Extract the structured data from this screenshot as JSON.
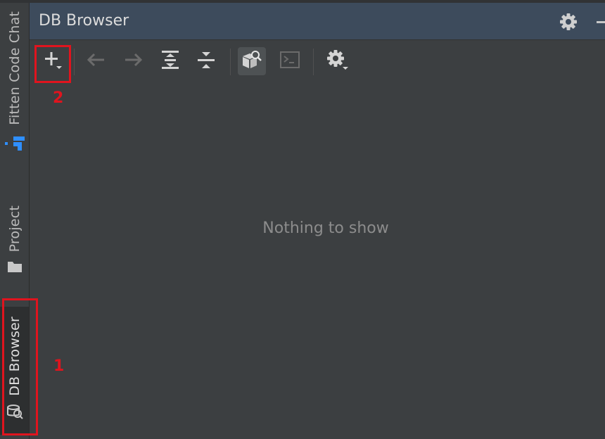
{
  "window": {
    "title": "DB Browser",
    "empty_state": "Nothing to show"
  },
  "side_tabs": [
    {
      "label": "Fitten Code Chat",
      "icon": "fitten-logo-icon"
    },
    {
      "label": "Project",
      "icon": "folder-icon"
    },
    {
      "label": "DB Browser",
      "icon": "db-browser-icon"
    }
  ],
  "toolbar": {
    "items": [
      "add-connection-icon",
      "back-icon",
      "forward-icon",
      "expand-all-icon",
      "collapse-all-icon",
      "object-browser-icon",
      "console-icon",
      "settings-icon"
    ]
  },
  "annotations": [
    {
      "number": "1",
      "target": "DB Browser tab"
    },
    {
      "number": "2",
      "target": "add connection button"
    }
  ],
  "colors": {
    "header_bg": "#3d4b5c",
    "panel_bg": "#3c3f41",
    "annotation": "#e0141e",
    "fitten_accent": "#2f8fff"
  }
}
